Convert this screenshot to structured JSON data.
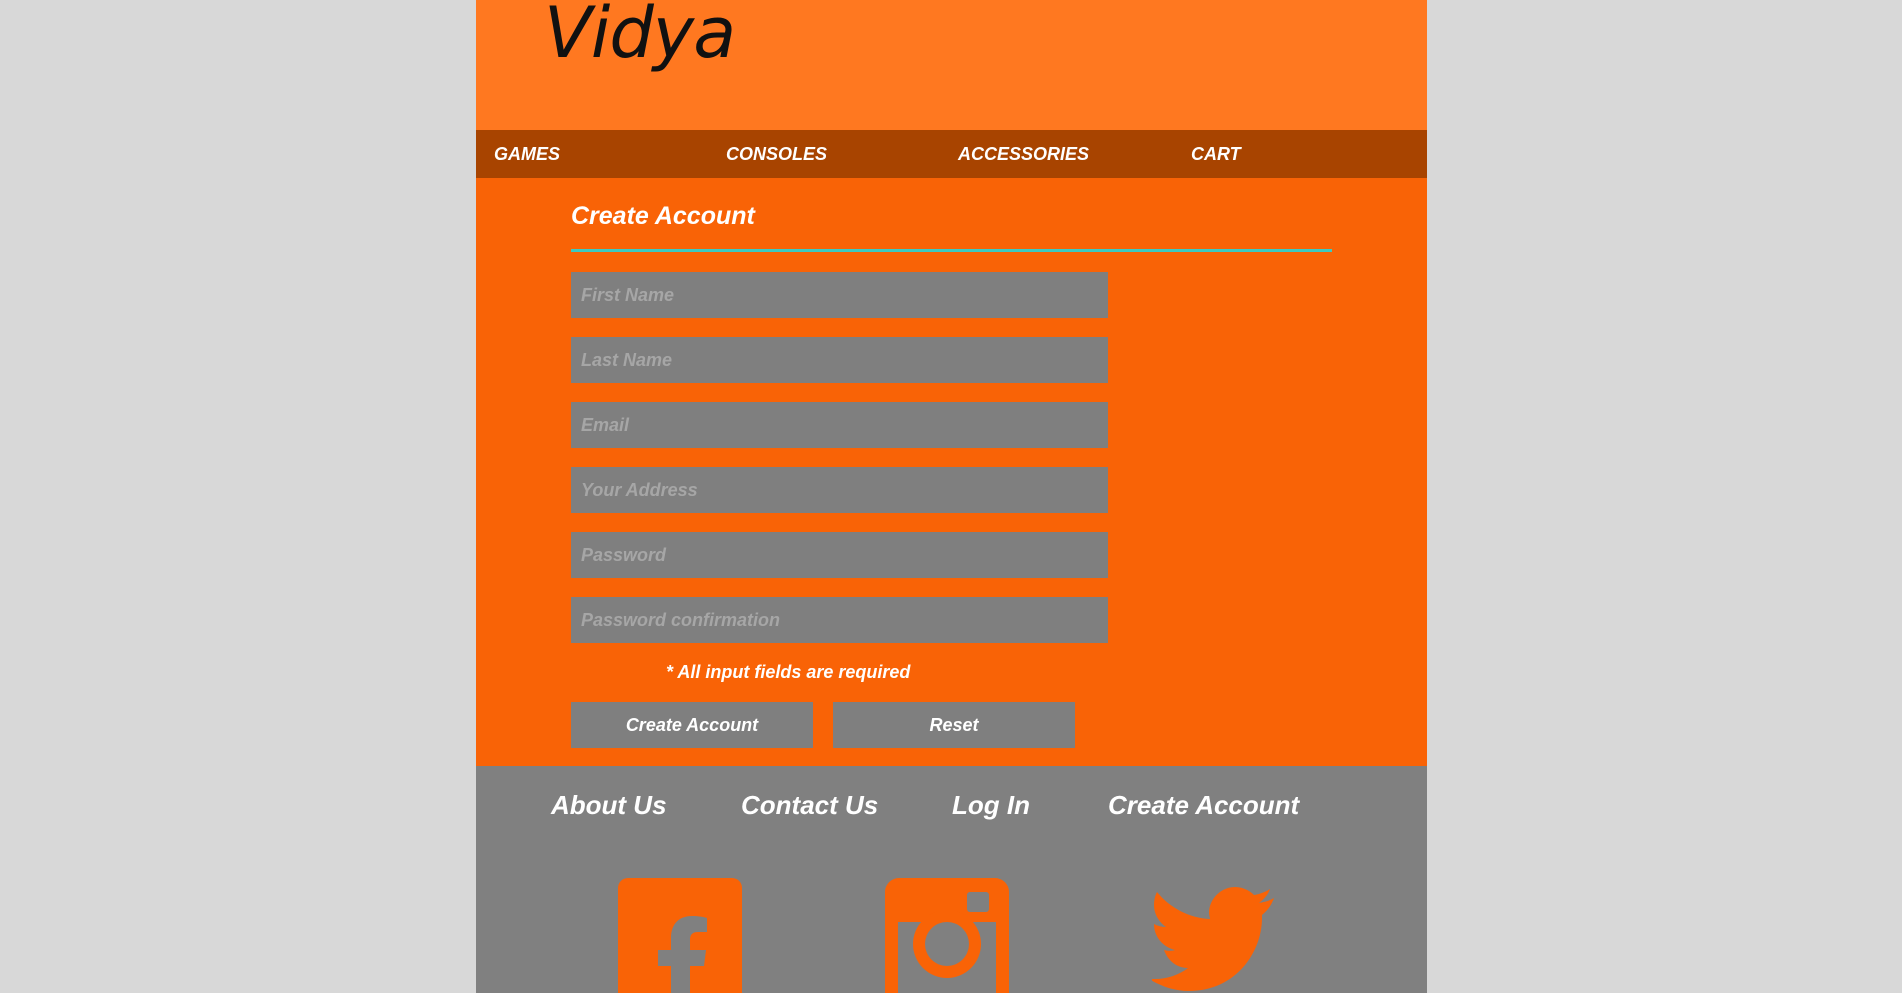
{
  "header": {
    "logo_text": "Vidya"
  },
  "nav": {
    "items": [
      "GAMES",
      "CONSOLES",
      "ACCESSORIES",
      "CART"
    ]
  },
  "form": {
    "title": "Create Account",
    "fields": [
      {
        "placeholder": "First Name",
        "value": ""
      },
      {
        "placeholder": "Last Name",
        "value": ""
      },
      {
        "placeholder": "Email",
        "value": ""
      },
      {
        "placeholder": "Your Address",
        "value": ""
      },
      {
        "placeholder": "Password",
        "value": ""
      },
      {
        "placeholder": "Password confirmation",
        "value": ""
      }
    ],
    "required_note": "* All input fields are required",
    "submit_label": "Create Account",
    "reset_label": "Reset"
  },
  "footer": {
    "links": [
      "About Us",
      "Contact Us",
      "Log In",
      "Create Account"
    ],
    "social_icons": [
      "facebook-icon",
      "instagram-icon",
      "twitter-icon"
    ]
  },
  "colors": {
    "header_bg": "#ff7820",
    "nav_bg": "#a84400",
    "main_bg": "#f96306",
    "accent_rule": "#3ec9c0",
    "field_bg": "#7f7f7f",
    "footer_bg": "#808080",
    "icon_color": "#f96306"
  }
}
